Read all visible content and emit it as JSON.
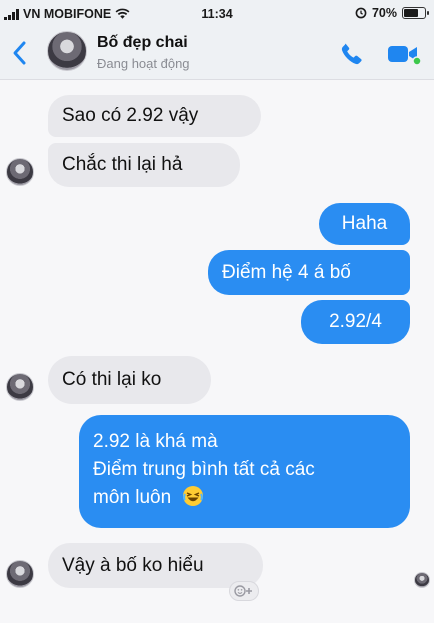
{
  "status_bar": {
    "carrier": "VN MOBIFONE",
    "time": "11:34",
    "battery": "70%",
    "battery_level": 0.7
  },
  "header": {
    "contact_name": "Bố đẹp chai",
    "presence": "Đang hoạt động",
    "accent_color": "#1f86f0"
  },
  "messages": [
    {
      "sender": "contact",
      "text": "Sao có 2.92 vậy"
    },
    {
      "sender": "contact",
      "text": "Chắc thi lại hả"
    },
    {
      "sender": "me",
      "text": "Haha"
    },
    {
      "sender": "me",
      "text": "Điểm hệ 4 á bố"
    },
    {
      "sender": "me",
      "text": "2.92/4"
    },
    {
      "sender": "contact",
      "text": "Có thi lại ko"
    },
    {
      "sender": "me",
      "lines": [
        "2.92 là khá mà",
        "Điểm trung bình tất cả các",
        "môn luôn"
      ],
      "emoji": "😂"
    },
    {
      "sender": "contact",
      "text": "Vậy à bố ko hiểu"
    }
  ],
  "icons": [
    "back-chevron",
    "phone",
    "video-camera",
    "add-reaction",
    "wifi",
    "alarm-lock"
  ]
}
